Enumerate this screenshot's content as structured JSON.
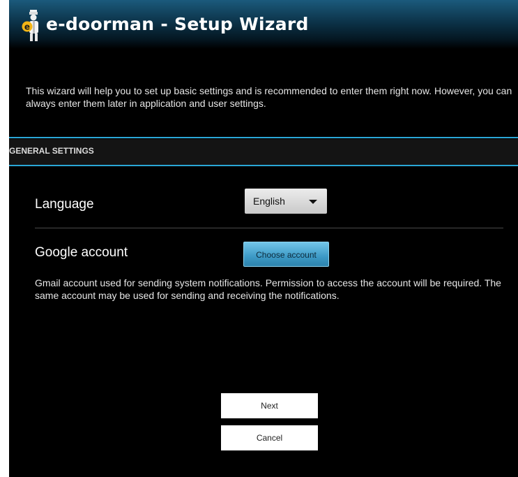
{
  "header": {
    "title": "e-doorman - Setup Wizard",
    "icon": "doorman-icon"
  },
  "intro_text": "This wizard will help you to set up basic settings and is recommended to enter them right now. However, you can always enter them later in application and user settings.",
  "section": {
    "title": "GENERAL SETTINGS"
  },
  "settings": {
    "language": {
      "label": "Language",
      "selected": "English"
    },
    "google_account": {
      "label": "Google account",
      "button_label": "Choose account",
      "description": "Gmail account used for sending system notifications. Permission to access the account will be required. The same account may be used for sending and receiving the notifications."
    }
  },
  "actions": {
    "next_label": "Next",
    "cancel_label": "Cancel"
  },
  "colors": {
    "accent": "#2aa6d6",
    "background": "#000000",
    "button_primary": "#3d9ac6"
  }
}
